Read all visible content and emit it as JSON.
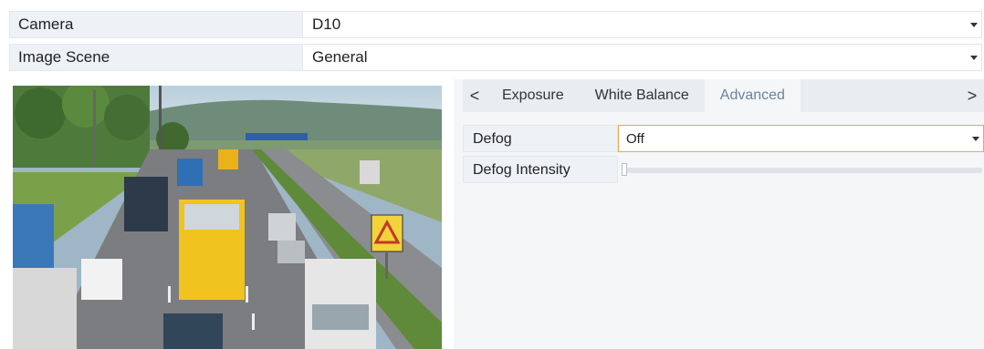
{
  "camera": {
    "label": "Camera",
    "value": "D10"
  },
  "image_scene": {
    "label": "Image Scene",
    "value": "General"
  },
  "tabs": {
    "items": [
      {
        "label": "Exposure"
      },
      {
        "label": "White Balance"
      },
      {
        "label": "Advanced",
        "active": true
      }
    ],
    "left_arrow": "<",
    "right_arrow": ">"
  },
  "advanced": {
    "defog": {
      "label": "Defog",
      "value": "Off"
    },
    "defog_intensity": {
      "label": "Defog Intensity",
      "level": 0
    }
  },
  "colors": {
    "label_bg": "#eef1f5",
    "active_tab_text": "#6d8399",
    "focus_border": "#f0a54a"
  },
  "preview": {
    "description_icon": "traffic-camera-preview"
  }
}
